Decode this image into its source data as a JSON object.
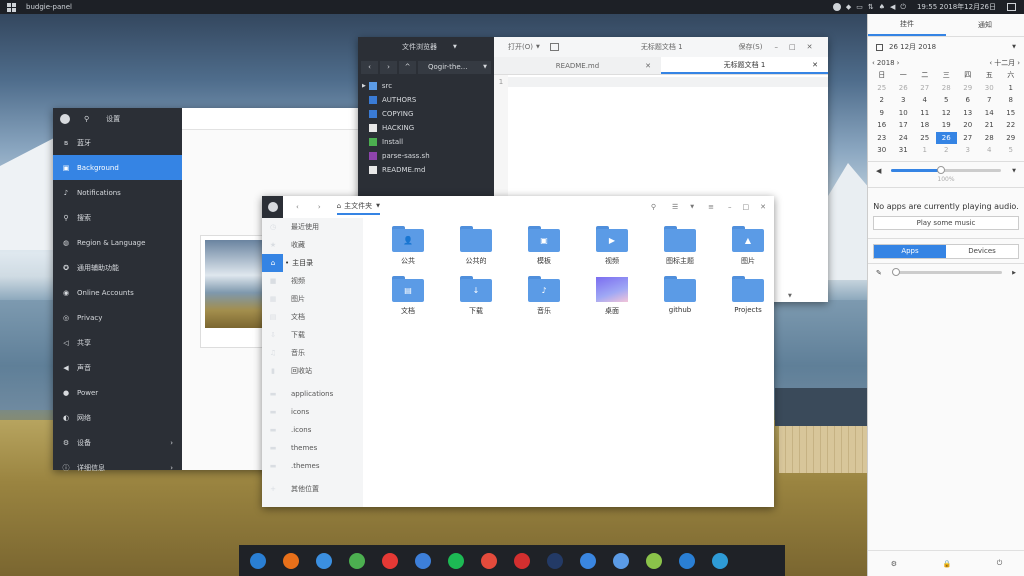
{
  "panel": {
    "app_menu_label": "budgie-panel",
    "clock": "19:55 2018年12月26日"
  },
  "settings": {
    "title": "设置",
    "items": [
      {
        "label": "蓝牙",
        "icon": "bluetooth-icon"
      },
      {
        "label": "Background",
        "icon": "image-icon"
      },
      {
        "label": "Notifications",
        "icon": "bell-icon"
      },
      {
        "label": "搜索",
        "icon": "search-icon"
      },
      {
        "label": "Region & Language",
        "icon": "globe-icon"
      },
      {
        "label": "通用辅助功能",
        "icon": "accessibility-icon"
      },
      {
        "label": "Online Accounts",
        "icon": "accounts-icon"
      },
      {
        "label": "Privacy",
        "icon": "privacy-icon"
      },
      {
        "label": "共享",
        "icon": "share-icon"
      },
      {
        "label": "声音",
        "icon": "volume-icon"
      },
      {
        "label": "Power",
        "icon": "power-icon"
      },
      {
        "label": "网络",
        "icon": "network-icon"
      },
      {
        "label": "设备",
        "icon": "devices-icon"
      },
      {
        "label": "详细信息",
        "icon": "info-icon"
      }
    ]
  },
  "editor": {
    "sidebar_title": "文件浏览器",
    "path_label": "Qogir-the…",
    "open_label": "打开(O)",
    "title": "无标题文档 1",
    "save_label": "保存(S)",
    "tabs": [
      "README.md",
      "无标题文档 1"
    ],
    "line_number": "1",
    "files": [
      {
        "name": "src",
        "color": "#5b9be6"
      },
      {
        "name": "AUTHORS",
        "color": "#3a7bd5"
      },
      {
        "name": "COPYING",
        "color": "#3a7bd5"
      },
      {
        "name": "HACKING",
        "color": "#e8e8e8"
      },
      {
        "name": "Install",
        "color": "#4caf50"
      },
      {
        "name": "parse-sass.sh",
        "color": "#8e44ad"
      },
      {
        "name": "README.md",
        "color": "#e8e8e8"
      }
    ]
  },
  "files": {
    "location": "主文件夹",
    "sidebar": [
      {
        "label": "最近使用",
        "icon": "clock-icon"
      },
      {
        "label": "收藏",
        "icon": "star-icon"
      },
      {
        "label": "主目录",
        "icon": "home-icon"
      },
      {
        "label": "视频",
        "icon": "video-icon"
      },
      {
        "label": "图片",
        "icon": "picture-icon"
      },
      {
        "label": "文档",
        "icon": "document-icon"
      },
      {
        "label": "下载",
        "icon": "download-icon"
      },
      {
        "label": "音乐",
        "icon": "music-icon"
      },
      {
        "label": "回收站",
        "icon": "trash-icon"
      },
      {
        "label": "applications",
        "icon": "folder-icon"
      },
      {
        "label": "icons",
        "icon": "folder-icon"
      },
      {
        "label": ".icons",
        "icon": "folder-icon"
      },
      {
        "label": "themes",
        "icon": "folder-icon"
      },
      {
        "label": ".themes",
        "icon": "folder-icon"
      },
      {
        "label": "其他位置",
        "icon": "plus-icon"
      }
    ],
    "folders": [
      {
        "label": "公共",
        "glyph": "👤"
      },
      {
        "label": "公共的",
        "glyph": ""
      },
      {
        "label": "模板",
        "glyph": "▣"
      },
      {
        "label": "视频",
        "glyph": "▶"
      },
      {
        "label": "图标主题",
        "glyph": ""
      },
      {
        "label": "图片",
        "glyph": "▲"
      },
      {
        "label": "文档",
        "glyph": "▤"
      },
      {
        "label": "下载",
        "glyph": "↓"
      },
      {
        "label": "音乐",
        "glyph": "♪"
      },
      {
        "label": "桌面",
        "glyph": ""
      },
      {
        "label": "github",
        "glyph": ""
      },
      {
        "label": "Projects",
        "glyph": ""
      }
    ]
  },
  "raven": {
    "tabs": [
      "挂件",
      "通知"
    ],
    "date_label": "26 12月 2018",
    "year": "2018",
    "month": "十二月",
    "weekdays": [
      "日",
      "一",
      "二",
      "三",
      "四",
      "五",
      "六"
    ],
    "days": [
      "25",
      "26",
      "27",
      "28",
      "29",
      "30",
      "1",
      "2",
      "3",
      "4",
      "5",
      "6",
      "7",
      "8",
      "9",
      "10",
      "11",
      "12",
      "13",
      "14",
      "15",
      "16",
      "17",
      "18",
      "19",
      "20",
      "21",
      "22",
      "23",
      "24",
      "25",
      "26",
      "27",
      "28",
      "29",
      "30",
      "31",
      "1",
      "2",
      "3",
      "4",
      "5"
    ],
    "volume_percent": "100%",
    "volume_level": 0.45,
    "no_apps": "No apps are currently playing audio.",
    "play_music": "Play some music",
    "apps_tab": "Apps",
    "devices_tab": "Devices",
    "mic_level": 0.02
  },
  "dock": {
    "apps": [
      {
        "name": "budgie-icon",
        "color": "#2a7fd4"
      },
      {
        "name": "firefox-icon",
        "color": "#e8701a"
      },
      {
        "name": "mail-icon",
        "color": "#3b8fe0"
      },
      {
        "name": "chrome-icon",
        "color": "#4caf50"
      },
      {
        "name": "vivaldi-icon",
        "color": "#e53935"
      },
      {
        "name": "calendar-icon",
        "color": "#3d7fd9"
      },
      {
        "name": "spotify-icon",
        "color": "#1db954"
      },
      {
        "name": "ruby-icon",
        "color": "#e44b3c"
      },
      {
        "name": "netease-icon",
        "color": "#d32f2f"
      },
      {
        "name": "audio-icon",
        "color": "#233a66"
      },
      {
        "name": "browser-icon",
        "color": "#3a86e0"
      },
      {
        "name": "files-icon",
        "color": "#5b9be6"
      },
      {
        "name": "screenshot-icon",
        "color": "#8bc34a"
      },
      {
        "name": "budgie2-icon",
        "color": "#2a7fd4"
      },
      {
        "name": "typora-icon",
        "color": "#2e9bd6"
      }
    ]
  }
}
